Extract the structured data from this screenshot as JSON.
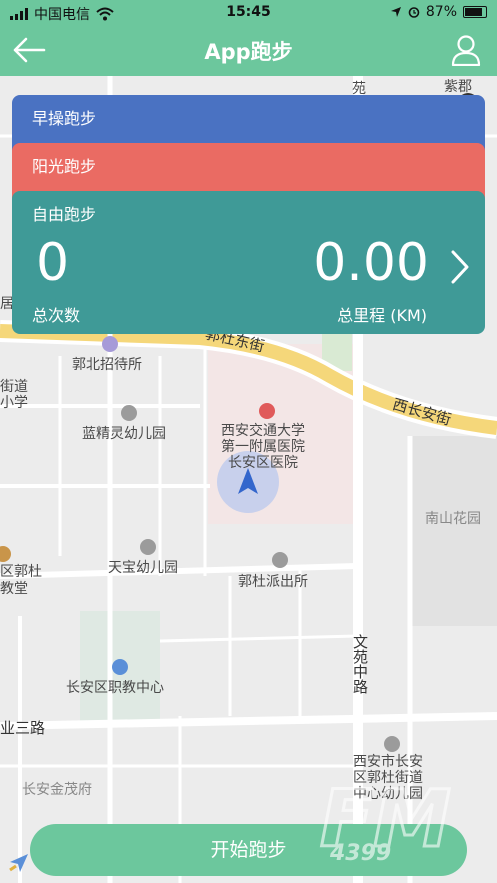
{
  "status_bar": {
    "carrier": "中国电信",
    "time": "15:45",
    "battery": "87%",
    "battery_level": 0.87
  },
  "nav": {
    "title": "App跑步"
  },
  "map_labels": {
    "road_east": "郭杜东街",
    "road_west_changan": "西长安街",
    "road_wenyuan": "文苑中路",
    "road_ye3": "业三路",
    "poi_guobei_hotel": "郭北招待所",
    "poi_lanjingling": "蓝精灵幼儿园",
    "poi_hospital": "西安交通大学\n第一附属医院\n长安区医院",
    "poi_nanshan": "南山花园",
    "poi_tianbao": "天宝幼儿园",
    "poi_police": "郭杜派出所",
    "poi_edu_left": "区郭杜\n教堂",
    "poi_vocational": "长安区职教中心",
    "poi_jinmao": "长安金茂府",
    "poi_kindergarten_right": "西安市长安\n区郭杜街道\n中心幼儿园",
    "edge_jie_xue": "街道\n小学",
    "edge_ju": "居",
    "top_yuan": "苑",
    "top_zidu": "紫郡"
  },
  "cards": {
    "morning": {
      "label": "早操跑步"
    },
    "sun": {
      "label": "阳光跑步"
    },
    "free": {
      "label": "自由跑步",
      "count": "0",
      "distance": "0.00",
      "count_label": "总次数",
      "distance_label": "总里程 (KM)"
    }
  },
  "start_button": {
    "label": "开始跑步"
  },
  "watermark": {
    "text": "4399",
    "logo": "FM"
  },
  "colors": {
    "primary": "#6cc79d",
    "morning": "#4a72c2",
    "sun": "#ea6b63",
    "free": "#3f9a97"
  }
}
